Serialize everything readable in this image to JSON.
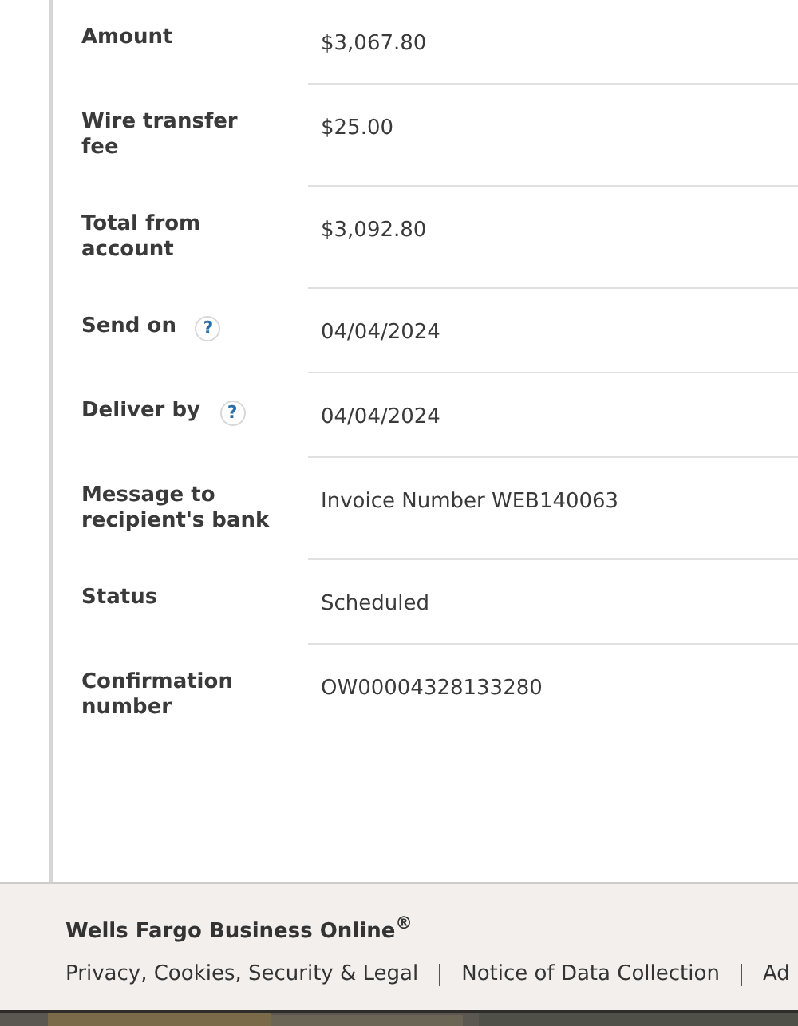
{
  "details": [
    {
      "label": "Amount",
      "value": "$3,067.80"
    },
    {
      "label": "Wire transfer fee",
      "value": "$25.00"
    },
    {
      "label": "Total from account",
      "value": "$3,092.80"
    },
    {
      "label": "Send on",
      "help": "?",
      "value": "04/04/2024"
    },
    {
      "label": "Deliver by",
      "help": "?",
      "value": "04/04/2024"
    },
    {
      "label": "Message to recipient's bank",
      "value": "Invoice Number WEB140063"
    },
    {
      "label": "Status",
      "value": "Scheduled"
    },
    {
      "label": "Confirmation number",
      "value": "OW00004328133280"
    }
  ],
  "footer": {
    "title": "Wells Fargo Business Online$^{®}$",
    "links": [
      "Privacy, Cookies, Security & Legal",
      "Notice of Data Collection",
      "Ad"
    ]
  }
}
